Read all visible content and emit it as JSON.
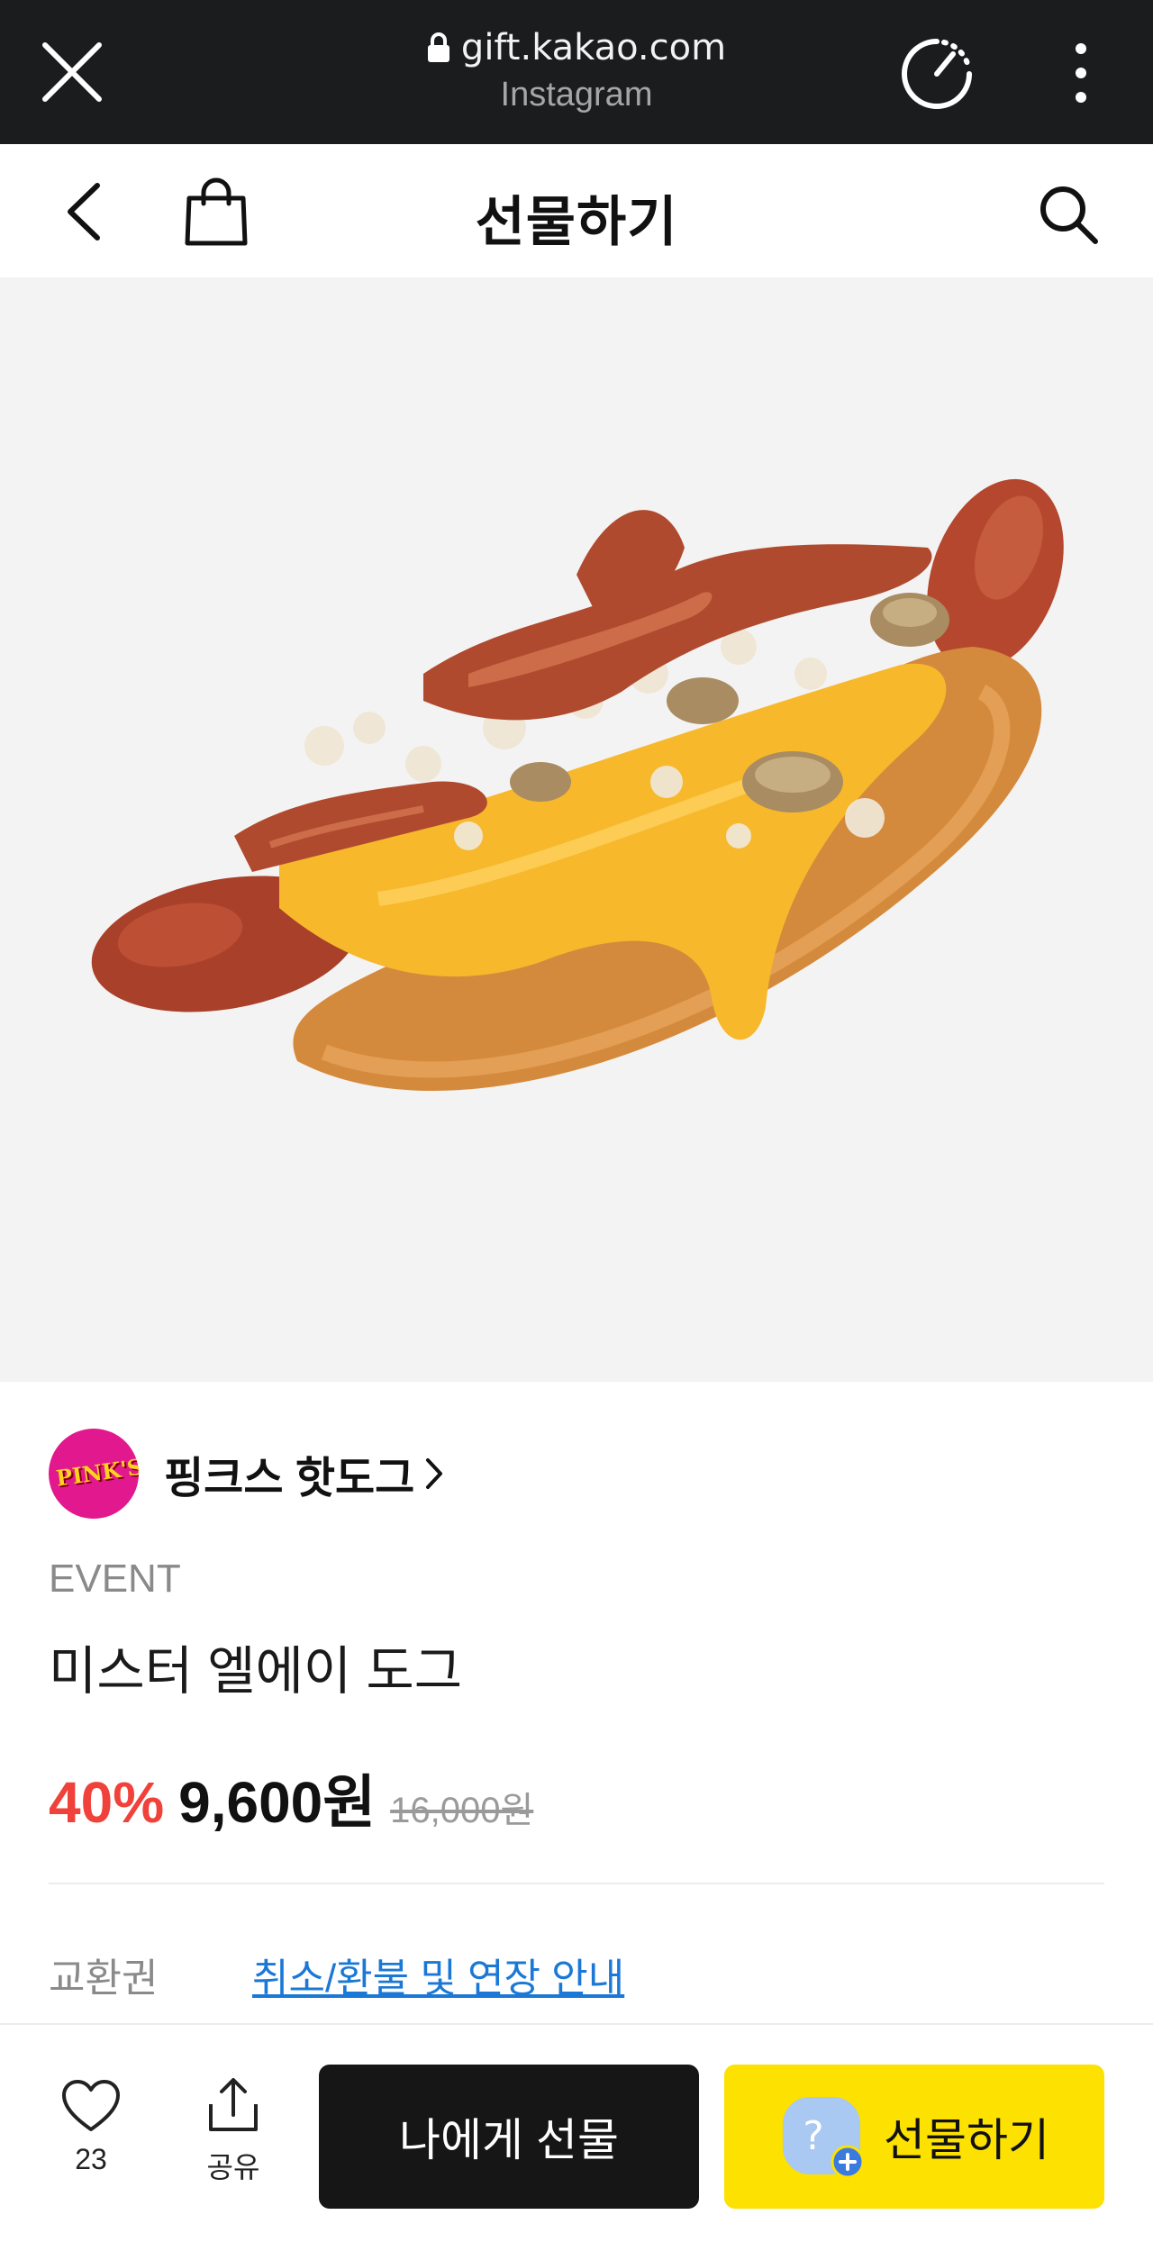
{
  "browser": {
    "domain": "gift.kakao.com",
    "source": "Instagram"
  },
  "header": {
    "title": "선물하기"
  },
  "product": {
    "brand_logo_text": "PINK'S",
    "brand": "핑크스 핫도그",
    "event": "EVENT",
    "name": "미스터 엘에이 도그",
    "discount": "40%",
    "price": "9,600원",
    "original_price": "16,000원"
  },
  "info": {
    "voucher_label": "교환권",
    "refund_link": "취소/환불 및 연장 안내"
  },
  "bottom": {
    "like_count": "23",
    "share_label": "공유",
    "self_gift_label": "나에게 선물",
    "gift_label": "선물하기"
  },
  "colors": {
    "discount": "#f0413a",
    "gift_button": "#fde100",
    "link": "#1b78d6",
    "browser_bar": "#1b1c1e"
  }
}
